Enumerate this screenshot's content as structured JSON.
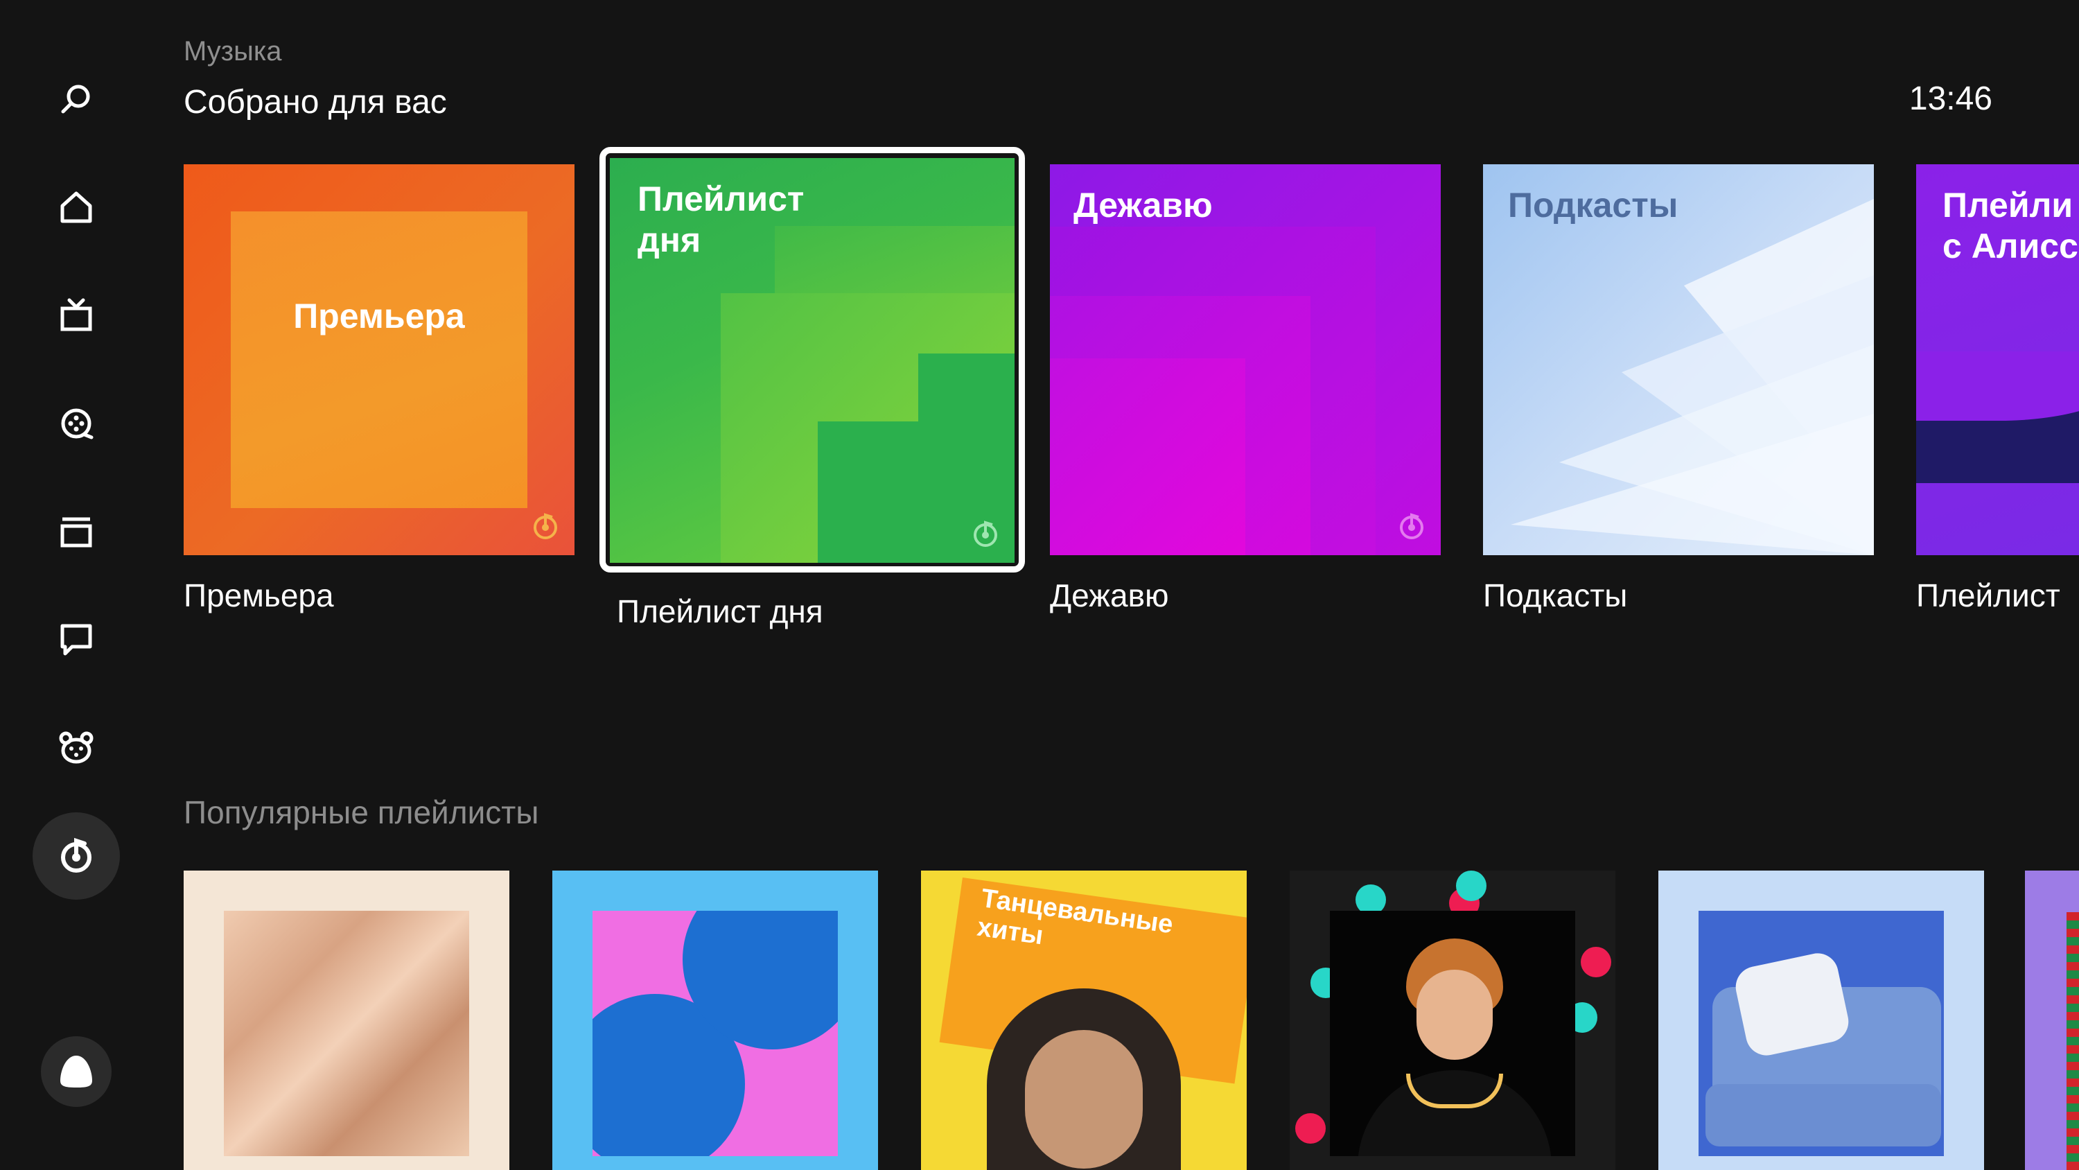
{
  "header": {
    "section_label": "Музыка",
    "title": "Собрано для вас",
    "clock": "13:46"
  },
  "sidebar": {
    "items": [
      {
        "icon": "search-icon"
      },
      {
        "icon": "home-icon"
      },
      {
        "icon": "tv-icon"
      },
      {
        "icon": "film-reel-icon"
      },
      {
        "icon": "collection-icon"
      },
      {
        "icon": "chat-icon"
      },
      {
        "icon": "bear-icon"
      },
      {
        "icon": "music-icon",
        "active": true
      }
    ],
    "alice_icon": "alice-icon"
  },
  "featured": {
    "cards": [
      {
        "cover_title": "Премьера",
        "caption": "Премьера",
        "color": "#ef5a1a"
      },
      {
        "cover_title": "Плейлист\nдня",
        "caption": "Плейлист дня",
        "color": "#2cae4f",
        "focused": true
      },
      {
        "cover_title": "Дежавю",
        "caption": "Дежавю",
        "color": "#a514e4"
      },
      {
        "cover_title": "Подкасты",
        "caption": "Подкасты",
        "color": "#9fc4f0"
      },
      {
        "cover_title": "Плейли\nс Алисс",
        "caption": "Плейлист",
        "color": "#8b21e8"
      }
    ]
  },
  "popular": {
    "title": "Популярные плейлисты",
    "cards": [
      {
        "text": ""
      },
      {
        "text": ""
      },
      {
        "text": "Танцевальные\nхиты"
      },
      {
        "text": ""
      },
      {
        "text": ""
      },
      {
        "text": ""
      }
    ]
  },
  "colors": {
    "background": "#141414",
    "focus": "#ffffff",
    "accent_orange": "#f39a2a"
  }
}
